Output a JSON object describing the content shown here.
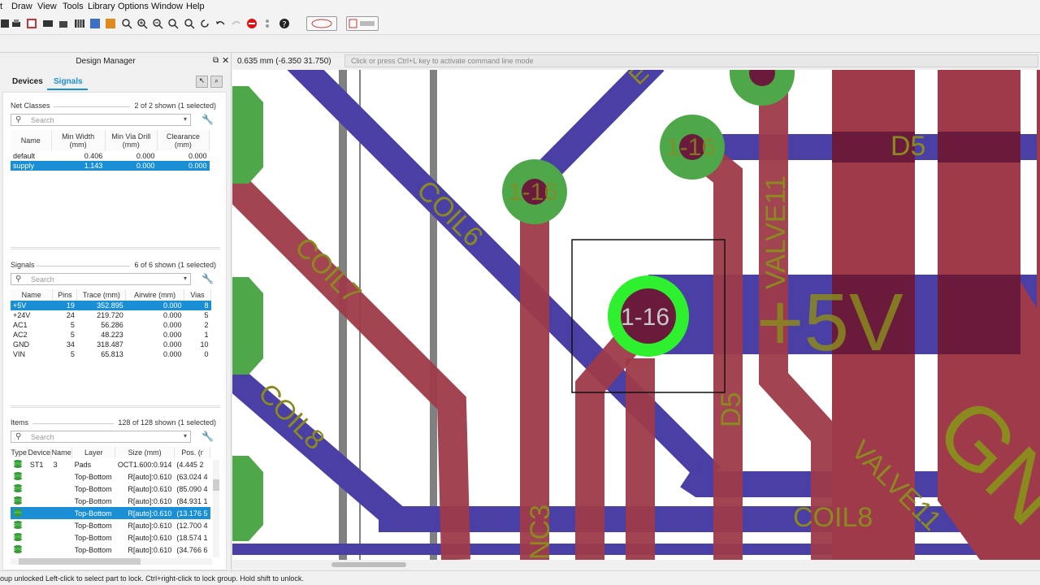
{
  "menu": [
    "t",
    "Draw",
    "View",
    "Tools",
    "Library",
    "Options",
    "Window",
    "Help"
  ],
  "toolbar_buttons": [
    "design-link",
    "pcb-quote"
  ],
  "design_manager": {
    "title": "Design Manager",
    "tabs": [
      "Devices",
      "Signals"
    ],
    "active_tab": "Signals",
    "net_classes": {
      "title": "Net Classes",
      "count": "2 of 2 shown (1 selected)",
      "search_placeholder": "Search",
      "columns": [
        "Name",
        "Min Width (mm)",
        "Min Via Drill (mm)",
        "Clearance (mm)"
      ],
      "rows": [
        [
          "default",
          "0.406",
          "0.000",
          "0.000"
        ],
        [
          "supply",
          "1.143",
          "0.000",
          "0.000"
        ]
      ],
      "selected_row": 1
    },
    "signals": {
      "title": "Signals",
      "count": "6 of 6 shown (1 selected)",
      "search_placeholder": "Search",
      "columns": [
        "Name",
        "Pins",
        "Trace (mm)",
        "Airwire (mm)",
        "Vias"
      ],
      "rows": [
        [
          "+5V",
          "19",
          "352.895",
          "0.000",
          "8"
        ],
        [
          "+24V",
          "24",
          "219.720",
          "0.000",
          "5"
        ],
        [
          "AC1",
          "5",
          "56.286",
          "0.000",
          "2"
        ],
        [
          "AC2",
          "5",
          "48.223",
          "0.000",
          "1"
        ],
        [
          "GND",
          "34",
          "318.487",
          "0.000",
          "10"
        ],
        [
          "VIN",
          "5",
          "65.813",
          "0.000",
          "0"
        ]
      ],
      "selected_row": 0
    },
    "items": {
      "title": "Items",
      "count": "128 of 128 shown (1 selected)",
      "search_placeholder": "Search",
      "columns": [
        "Type",
        "Device",
        "Name",
        "Layer",
        "Size (mm)",
        "Pos. (r"
      ],
      "rows": [
        [
          "ST1",
          "3",
          "Pads",
          "OCT1.600:0.914",
          "(4.445 2"
        ],
        [
          "",
          "",
          "Top-Bottom",
          "R[auto]:0.610",
          "(63.024 4"
        ],
        [
          "",
          "",
          "Top-Bottom",
          "R[auto]:0.610",
          "(85.090 4"
        ],
        [
          "",
          "",
          "Top-Bottom",
          "R[auto]:0.610",
          "(84.931 1"
        ],
        [
          "",
          "",
          "Top-Bottom",
          "R[auto]:0.610",
          "(13.176 5"
        ],
        [
          "",
          "",
          "Top-Bottom",
          "R[auto]:0.610",
          "(12.700 4"
        ],
        [
          "",
          "",
          "Top-Bottom",
          "R[auto]:0.610",
          "(18.574 1"
        ],
        [
          "",
          "",
          "Top-Bottom",
          "R[auto]:0.610",
          "(34.766 6"
        ]
      ],
      "selected_row": 4
    }
  },
  "coords": "0.635 mm (-6.350 31.750)",
  "command_line_placeholder": "Click or press Ctrl+L key to activate command line mode",
  "canvas_labels": {
    "via_label": "1-16",
    "net_5v": "+5V",
    "coil6": "COIL6",
    "coil7": "COIL7",
    "coil8": "COIL8",
    "d5": "D5",
    "valve11": "VALVE11",
    "nc3": "NC3",
    "gnd": "GN",
    "e": "E"
  },
  "colors": {
    "top_layer": "#9e3a4a",
    "bottom_layer": "#4a3fa5",
    "via": "#4ea84a",
    "selected_via": "#2ef02e",
    "silk": "#8a8a1e",
    "selection": "#1a8fd6"
  },
  "status": "oup unlocked Left-click to select part to lock. Ctrl+right-click to lock group. Hold shift to unlock."
}
